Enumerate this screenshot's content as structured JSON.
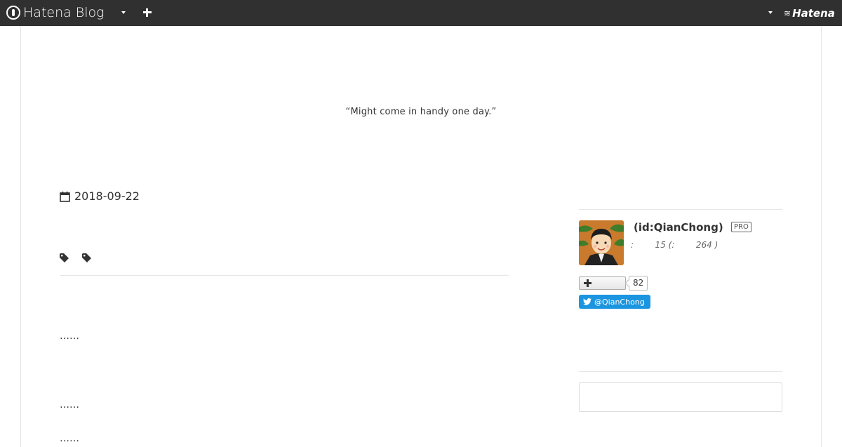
{
  "topbar": {
    "logo_text": "Hatena Blog",
    "right_brand": "Hatena",
    "bg_color": "#303030"
  },
  "blog": {
    "tagline": "“Might come in handy one day.”"
  },
  "entry": {
    "date": "2018-09-22",
    "ellipsis_1": "……",
    "ellipsis_2": " ……",
    "ellipsis_3": "……"
  },
  "sidebar": {
    "user_id": "(id:QianChong)",
    "pro_label": "PRO",
    "stats_text": ":        15 (:        264 )",
    "follower_count": "82",
    "twitter_handle": "@QianChong",
    "twitter_color": "#1b95e0"
  }
}
